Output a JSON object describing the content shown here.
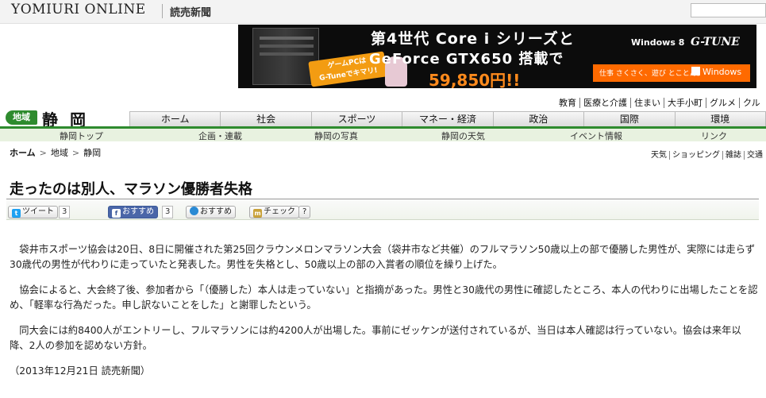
{
  "header": {
    "logo": "YOMIURI ONLINE",
    "logo_sub": "読売新聞",
    "search_placeholder": ""
  },
  "ad": {
    "line1": "第4世代 Core i シリーズと",
    "line2": "GeForce GTX650 搭載で",
    "price": "59,850円!!",
    "badge_line1": "ゲームPCは",
    "badge_line2": "G-Tuneでキマリ!",
    "os": "Windows 8",
    "brand": "G-TUNE",
    "tagline": "仕事 さくさく、遊び とことん。",
    "windows_button": "Windows"
  },
  "region_links": [
    "教育",
    "医療と介護",
    "住まい",
    "大手小町",
    "グルメ",
    "クル"
  ],
  "region": {
    "badge": "地域",
    "name": "静 岡"
  },
  "nav": {
    "tabs": [
      "ホーム",
      "社会",
      "スポーツ",
      "マネー・経済",
      "政治",
      "国際",
      "環境"
    ]
  },
  "subnav": {
    "items": [
      "静岡トップ",
      "企画・連載",
      "静岡の写真",
      "静岡の天気",
      "イベント情報",
      "リンク"
    ]
  },
  "breadcrumb": {
    "items": [
      "ホーム",
      "地域",
      "静岡"
    ],
    "separator": ">"
  },
  "util_links": [
    "天気",
    "ショッピング",
    "雑誌",
    "交通"
  ],
  "article": {
    "headline": "走ったのは別人、マラソン優勝者失格",
    "paragraphs": [
      "袋井市スポーツ協会は20日、8日に開催された第25回クラウンメロンマラソン大会（袋井市など共催）のフルマラソン50歳以上の部で優勝した男性が、実際には走らず30歳代の男性が代わりに走っていたと発表した。男性を失格とし、50歳以上の部の入賞者の順位を繰り上げた。",
      "協会によると、大会終了後、参加者から「（優勝した）本人は走っていない」と指摘があった。男性と30歳代の男性に確認したところ、本人の代わりに出場したことを認め、「軽率な行為だった。申し訳ないことをした」と謝罪したという。",
      "同大会には約8400人がエントリーし、フルマラソンには約4200人が出場した。事前にゼッケンが送付されているが、当日は本人確認は行っていない。協会は来年以降、2人の参加を認めない方針。"
    ],
    "dateline": "（2013年12月21日  読売新聞）"
  },
  "social": {
    "tweet_label": "ツイート",
    "tweet_count": "3",
    "fb_label": "おすすめ",
    "fb_count": "3",
    "mixi_label": "おすすめ",
    "check_label": "チェック",
    "help_label": "?"
  },
  "colors": {
    "region_green": "#2e8b2e",
    "ad_orange": "#ff6a00",
    "subnav_bg": "#e8f2e0"
  }
}
